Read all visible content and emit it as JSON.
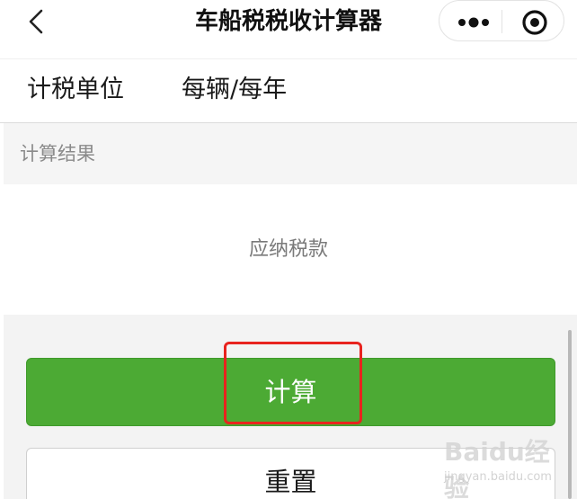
{
  "header": {
    "back_icon": "chevron-left-icon",
    "title": "车船税税收计算器",
    "more_icon": "more-dots-icon",
    "close_icon": "target-close-icon"
  },
  "tax_unit": {
    "label": "计税单位",
    "value": "每辆/每年"
  },
  "result": {
    "section_title": "计算结果",
    "tax_label": "应纳税款"
  },
  "buttons": {
    "calculate_label": "计算",
    "reset_label": "重置"
  },
  "annotation": {
    "color": "#e8231e"
  },
  "colors": {
    "primary_green": "#4caa34",
    "section_bg": "#f5f5f5"
  },
  "watermark": {
    "logo_text": "Baidu经验",
    "url": "jingyan.baidu.com"
  }
}
